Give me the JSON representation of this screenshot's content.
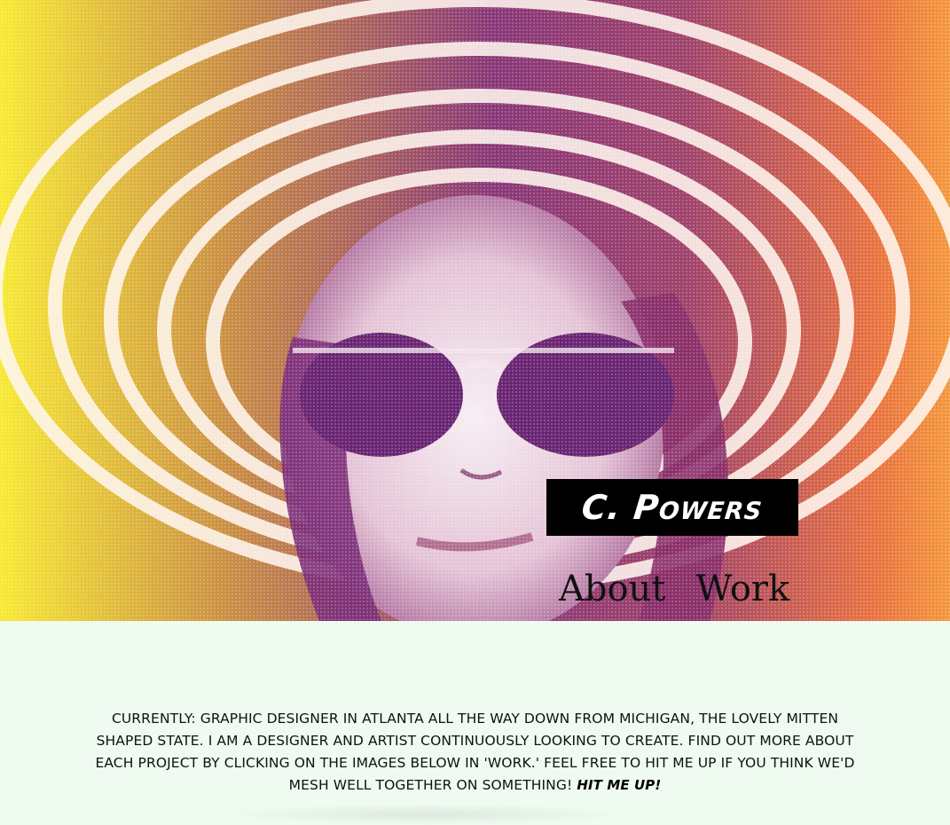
{
  "brand": {
    "name": "C. Powers"
  },
  "nav": {
    "about": "About",
    "work": "Work"
  },
  "bio": {
    "text": "Currently: Graphic designer in Atlanta all the way down from Michigan, the lovely mitten shaped state. I am a designer and artist continuously looking to create. Find out more about each project by clicking on the images below in 'work.' Feel free to hit me up if you think we'd mesh well together on something!",
    "cta": "Hit me up!"
  },
  "colors": {
    "background": "#effbf1",
    "brand_box": "#000000",
    "gradient_yellow": "#f8e828",
    "gradient_purple": "#80266e",
    "gradient_orange": "#f58c28"
  },
  "hero_image": {
    "icon": "halftone-portrait-image"
  }
}
